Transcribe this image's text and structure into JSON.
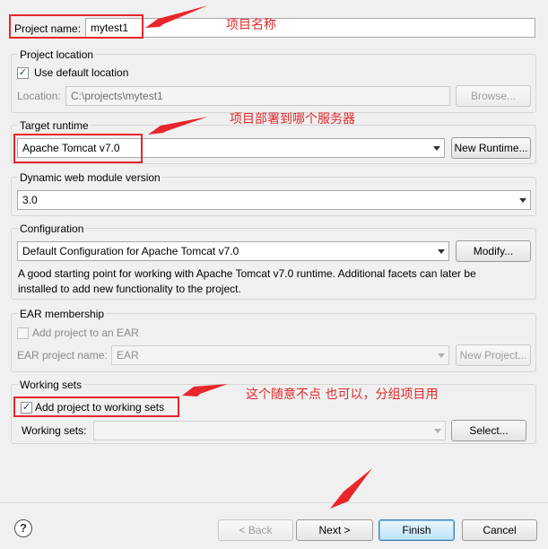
{
  "project_name": {
    "label": "Project name:",
    "value": "mytest1"
  },
  "project_location": {
    "group_title": "Project location",
    "use_default_label": "Use default location",
    "location_label": "Location:",
    "location_value": "C:\\projects\\mytest1",
    "browse_label": "Browse..."
  },
  "target_runtime": {
    "group_title": "Target runtime",
    "selected": "Apache Tomcat v7.0",
    "new_runtime_label": "New Runtime..."
  },
  "web_module": {
    "group_title": "Dynamic web module version",
    "selected": "3.0"
  },
  "configuration": {
    "group_title": "Configuration",
    "selected": "Default Configuration for Apache Tomcat v7.0",
    "modify_label": "Modify...",
    "description_line1": "A good starting point for working with Apache Tomcat v7.0  runtime. Additional facets can later be",
    "description_line2": "installed to add new functionality to the project."
  },
  "ear": {
    "group_title": "EAR membership",
    "add_label": "Add project to an EAR",
    "name_label": "EAR project name:",
    "name_value": "EAR",
    "new_project_label": "New Project..."
  },
  "working_sets": {
    "group_title": "Working sets",
    "add_label": "Add project to working sets",
    "sets_label": "Working sets:",
    "sets_value": "",
    "select_label": "Select..."
  },
  "footer": {
    "help_glyph": "?",
    "back_label": "< Back",
    "next_label": "Next >",
    "finish_label": "Finish",
    "cancel_label": "Cancel"
  },
  "annotations": {
    "project_name_note": "项目名称",
    "runtime_note": "项目部署到哪个服务器",
    "working_sets_note": "这个随意不点 也可以，分组项目用"
  },
  "colors": {
    "annotation_red": "#e2292a",
    "checkbox_mark": "#1c3c7a",
    "default_button": "#3c7fb1"
  },
  "state": {
    "use_default_location_checked": true,
    "add_to_ear_checked": false,
    "add_to_working_sets_checked": true
  }
}
